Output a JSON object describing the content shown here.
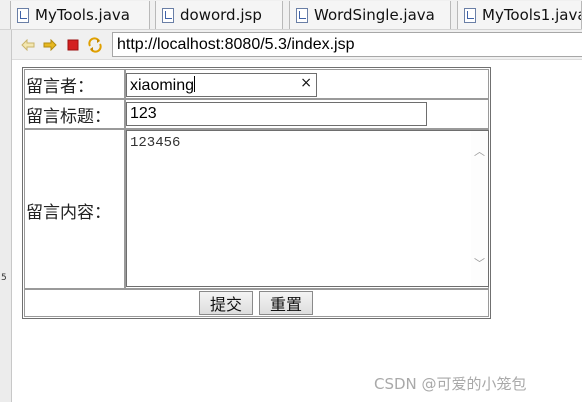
{
  "editor_tabs": [
    {
      "label": "MyTools.java"
    },
    {
      "label": "doword.jsp"
    },
    {
      "label": "WordSingle.java"
    },
    {
      "label": "MyTools1.java"
    }
  ],
  "toolbar": {
    "back_icon": "back-arrow",
    "forward_icon": "forward-arrow",
    "stop_icon": "stop-square",
    "refresh_icon": "refresh-arrows",
    "address": "http://localhost:8080/5.3/index.jsp"
  },
  "form": {
    "author_label": "留言者：",
    "author_value": "xiaoming",
    "clear_glyph": "×",
    "title_label": "留言标题：",
    "title_value": "123",
    "content_label": "留言内容：",
    "content_value": "123456",
    "submit_label": "提交",
    "reset_label": "重置"
  },
  "watermark": "CSDN @可爱的小笼包",
  "colors": {
    "stop_red": "#d32020",
    "arrow_yellow": "#e7b820",
    "border_gray": "#707070"
  }
}
